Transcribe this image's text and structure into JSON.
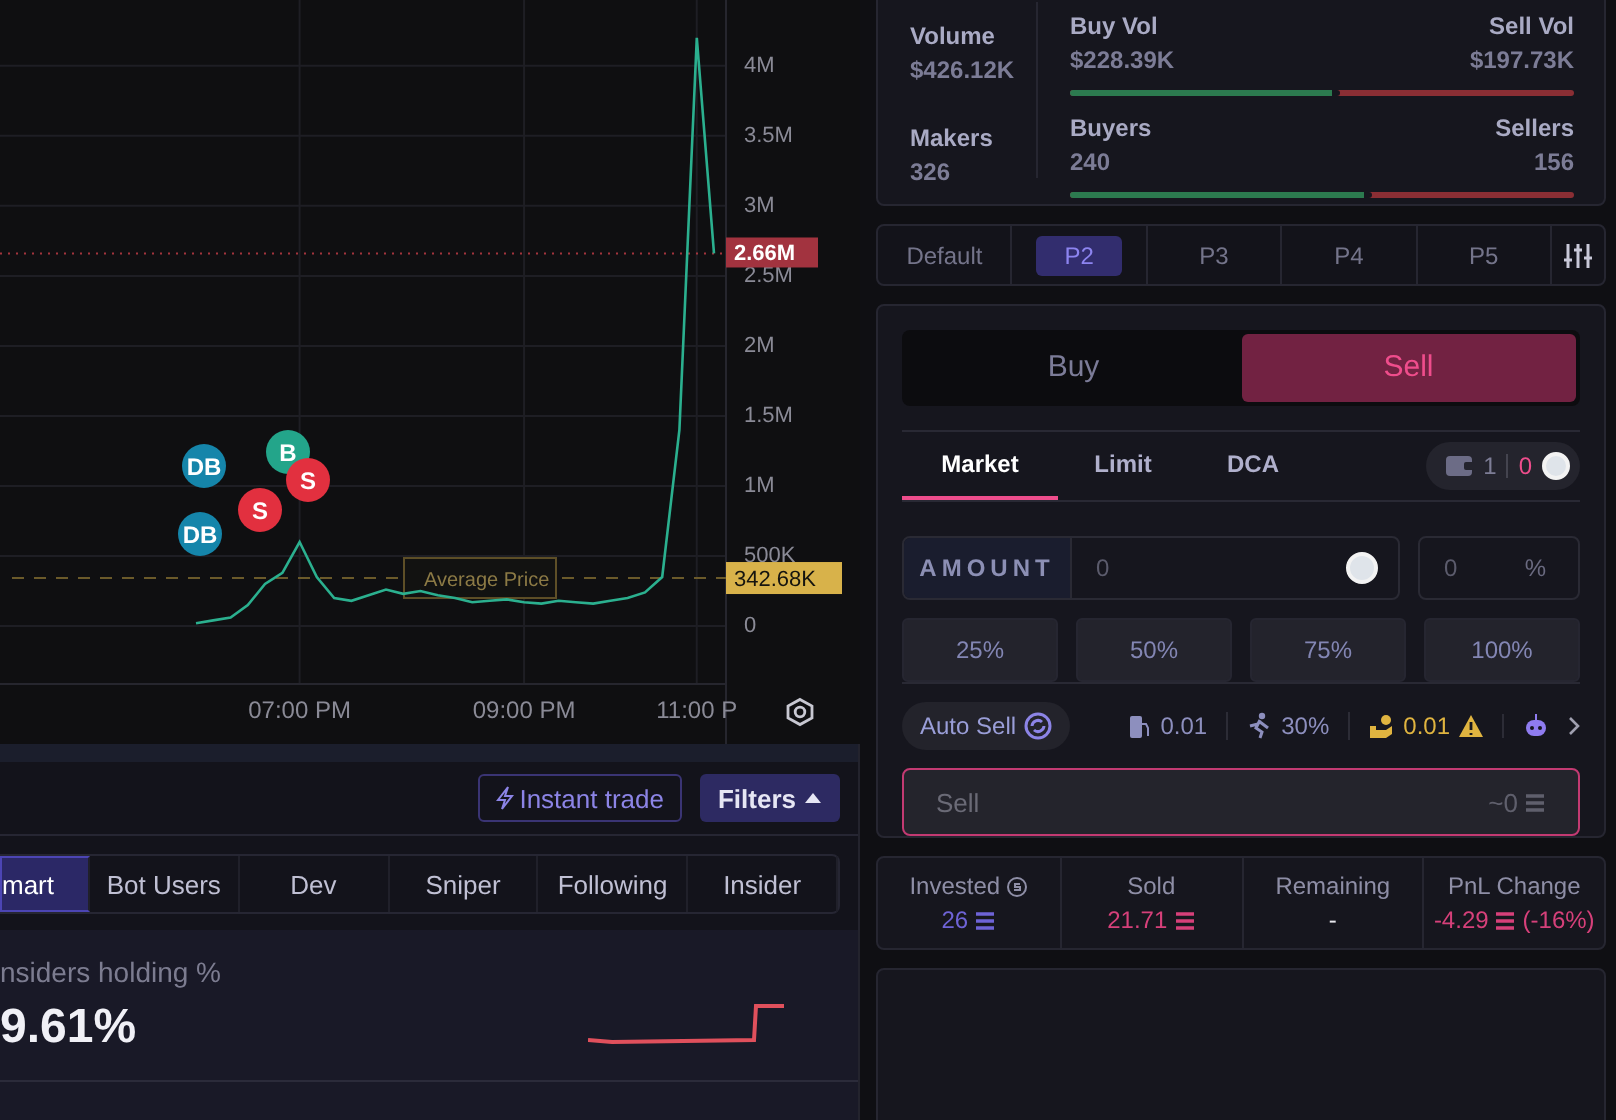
{
  "chart": {
    "chart_data": {
      "type": "line",
      "categories": [
        null,
        null,
        null,
        null,
        null,
        null,
        "07:00 PM",
        null,
        null,
        null,
        null,
        null,
        null,
        null,
        null,
        null,
        null,
        null,
        null,
        "09:00 PM",
        null,
        null,
        null,
        null,
        null,
        null,
        null,
        null,
        null,
        "11:00 P",
        null
      ],
      "series": [
        {
          "color": "#2bb08f",
          "values": [
            20000,
            40000,
            60000,
            150000,
            300000,
            380000,
            600000,
            350000,
            200000,
            180000,
            220000,
            260000,
            230000,
            250000,
            220000,
            200000,
            170000,
            180000,
            190000,
            170000,
            160000,
            180000,
            170000,
            160000,
            180000,
            200000,
            240000,
            350000,
            1400000,
            4200000,
            2660000
          ]
        }
      ],
      "ylim": [
        -414000,
        4470000
      ],
      "yticks": [
        {
          "value": 0,
          "label": "0"
        },
        {
          "value": 500000,
          "label": "500K"
        },
        {
          "value": 1000000,
          "label": "1M"
        },
        {
          "value": 1500000,
          "label": "1.5M"
        },
        {
          "value": 2000000,
          "label": "2M"
        },
        {
          "value": 2500000,
          "label": "2.5M"
        },
        {
          "value": 3000000,
          "label": "3M"
        },
        {
          "value": 3500000,
          "label": "3.5M"
        },
        {
          "value": 4000000,
          "label": "4M"
        }
      ],
      "grid": true,
      "ref_lines": [
        {
          "axis": "y",
          "value": 2660000
        },
        {
          "axis": "y",
          "value": 342680,
          "label": "Average Price"
        }
      ]
    },
    "price_tags": [
      {
        "kind": "current",
        "value": "2.66M"
      },
      {
        "kind": "average",
        "value": "342.68K"
      }
    ],
    "trade_markers": [
      {
        "label": "B",
        "color": "#23a58a"
      },
      {
        "label": "DB",
        "color": "#1585aa"
      },
      {
        "label": "S",
        "color": "#e2303f"
      },
      {
        "label": "S",
        "color": "#e2303f"
      },
      {
        "label": "DB",
        "color": "#1585aa"
      }
    ]
  },
  "stats": {
    "totals": [
      {
        "label": "Volume",
        "value": "$426.12K"
      },
      {
        "label": "Makers",
        "value": "326"
      }
    ],
    "splits": [
      {
        "left": {
          "label": "Buy Vol",
          "value": "$228.39K"
        },
        "right": {
          "label": "Sell Vol",
          "value": "$197.73K"
        },
        "level": 0.535
      },
      {
        "left": {
          "label": "Buyers",
          "value": "240"
        },
        "right": {
          "label": "Sellers",
          "value": "156"
        },
        "level": 0.6
      }
    ]
  },
  "presets": [
    {
      "label": "Default",
      "selected": false
    },
    {
      "label": "P2",
      "selected": true
    },
    {
      "label": "P3",
      "selected": false
    },
    {
      "label": "P4",
      "selected": false
    },
    {
      "label": "P5",
      "selected": false
    }
  ],
  "order": {
    "sides": [
      {
        "label": "Buy",
        "selected": false
      },
      {
        "label": "Sell",
        "selected": true
      }
    ],
    "types": [
      {
        "label": "Market",
        "selected": true
      },
      {
        "label": "Limit",
        "selected": false
      },
      {
        "label": "DCA",
        "selected": false
      }
    ],
    "wallet": {
      "count": "1",
      "alert": "0"
    },
    "amount": {
      "label": "AMOUNT",
      "placeholder": "0"
    },
    "percent": {
      "placeholder": "0",
      "unit": "%"
    },
    "quick": [
      "25%",
      "50%",
      "75%",
      "100%"
    ],
    "auto_sell": "Auto Sell",
    "settings": [
      {
        "kind": "gas",
        "value": "0.01",
        "warning": false
      },
      {
        "kind": "slippage",
        "value": "30%",
        "warning": false
      },
      {
        "kind": "tip",
        "value": "0.01",
        "warning": true
      },
      {
        "kind": "bot"
      }
    ],
    "submit": {
      "label": "Sell",
      "estimate": "~0",
      "disabled": true
    }
  },
  "position": [
    {
      "label": "Invested",
      "value": "26",
      "coin": true,
      "color": "#6e63d6"
    },
    {
      "label": "Sold",
      "value": "21.71",
      "coin": true,
      "color": "#d6407a"
    },
    {
      "label": "Remaining",
      "value": "-",
      "coin": false,
      "color": "#e8e8ee"
    },
    {
      "label": "PnL Change",
      "value": "-4.29",
      "coin": true,
      "suffix": "(-16%)",
      "color": "#d6407a"
    }
  ],
  "toolbar": {
    "instant_trade": "Instant trade",
    "filters": "Filters"
  },
  "holder_tabs": [
    {
      "label": "mart",
      "selected": true
    },
    {
      "label": "Bot Users",
      "selected": false
    },
    {
      "label": "Dev",
      "selected": false
    },
    {
      "label": "Sniper",
      "selected": false
    },
    {
      "label": "Following",
      "selected": false
    },
    {
      "label": "Insider",
      "selected": false
    }
  ],
  "insiders": {
    "label": "nsiders holding %",
    "value": "9.61%"
  }
}
